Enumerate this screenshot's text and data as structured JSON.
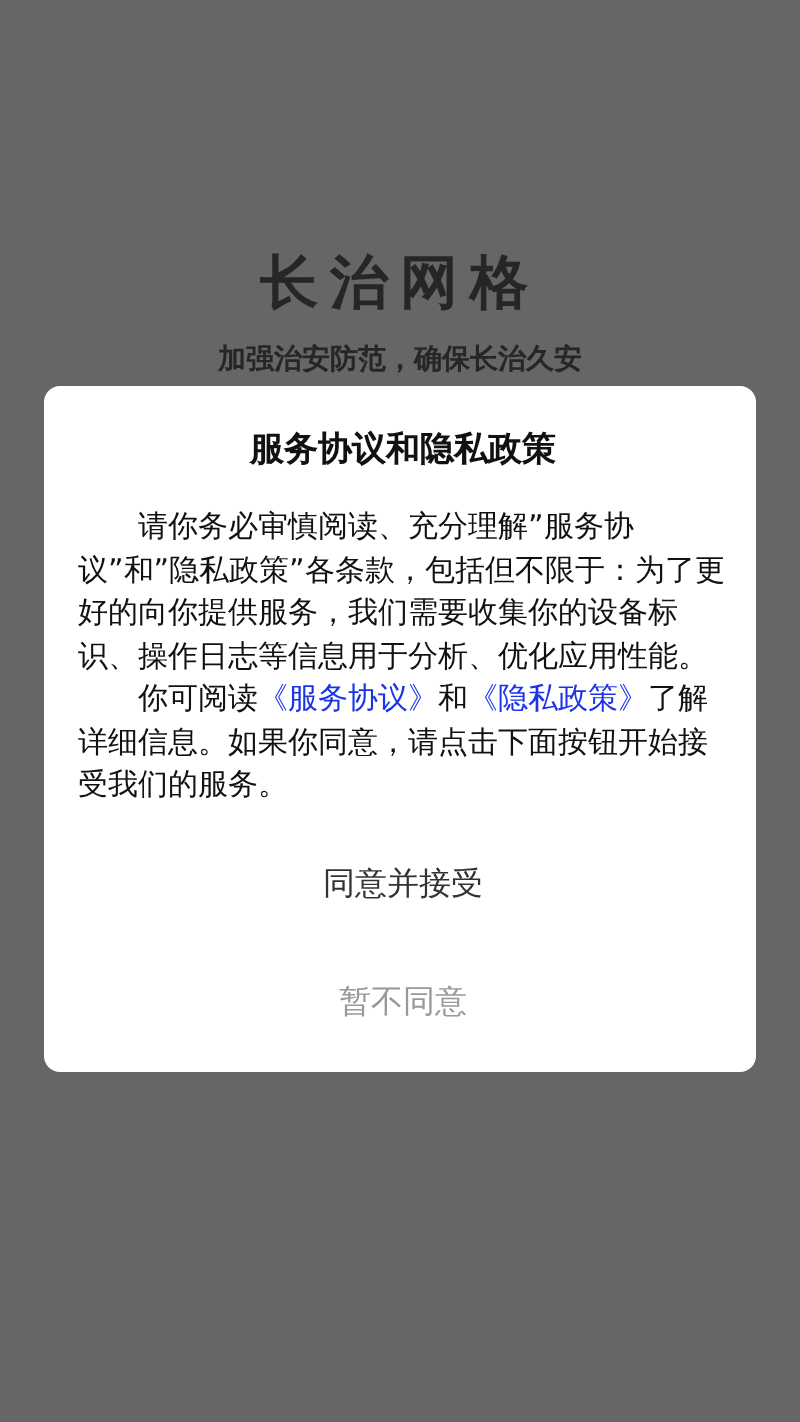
{
  "background": {
    "logo": "长治网格",
    "slogan": "加强治安防范，确保长治久安"
  },
  "dialog": {
    "title": "服务协议和隐私政策",
    "paragraphs": [
      [
        {
          "kind": "text",
          "text": "请你务必审慎阅读、充分理解”服务协议”和”隐私政策”各条款，包括但不限于：为了更好的向你提供服务，我们需要收集你的设备标识、操作日志等信息用于分析、优化应用性能。"
        }
      ],
      [
        {
          "kind": "text",
          "text": "你可阅读"
        },
        {
          "kind": "link",
          "text": "《服务协议》"
        },
        {
          "kind": "text",
          "text": "和"
        },
        {
          "kind": "link",
          "text": "《隐私政策》"
        },
        {
          "kind": "text",
          "text": "了解详细信息。如果你同意，请点击下面按钮开始接受我们的服务。"
        }
      ]
    ],
    "buttons": [
      {
        "label": "同意并接受",
        "kind": "primary"
      },
      {
        "label": "暂不同意",
        "kind": "secondary"
      }
    ]
  }
}
